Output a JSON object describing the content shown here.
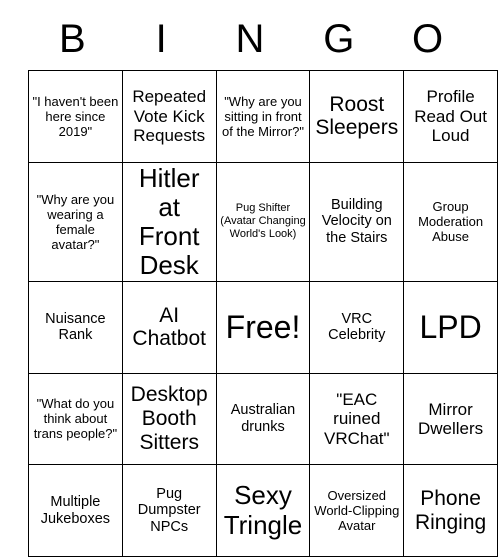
{
  "card": {
    "type": "bingo-card",
    "header": {
      "letters": [
        "B",
        "I",
        "N",
        "G",
        "O"
      ]
    },
    "grid": {
      "columns": 5,
      "rows": 5,
      "free_space_index": 12,
      "cells": [
        {
          "text": "\"I haven't been here since 2019\"",
          "size": "sm"
        },
        {
          "text": "Repeated Vote Kick Requests",
          "size": "lg"
        },
        {
          "text": "\"Why are you sitting in front of the Mirror?\"",
          "size": "sm"
        },
        {
          "text": "Roost Sleepers",
          "size": "xl"
        },
        {
          "text": "Profile Read Out Loud",
          "size": "lg"
        },
        {
          "text": "\"Why are you wearing a female avatar?\"",
          "size": "sm"
        },
        {
          "text": "Hitler at Front Desk",
          "size": "xxl"
        },
        {
          "text": "Pug Shifter (Avatar Changing World's Look)",
          "size": "xs"
        },
        {
          "text": "Building Velocity on the Stairs",
          "size": "md"
        },
        {
          "text": "Group Moderation Abuse",
          "size": "sm"
        },
        {
          "text": "Nuisance Rank",
          "size": "md"
        },
        {
          "text": "AI Chatbot",
          "size": "xl"
        },
        {
          "text": "Free!",
          "size": "huge"
        },
        {
          "text": "VRC Celebrity",
          "size": "md"
        },
        {
          "text": "LPD",
          "size": "huge"
        },
        {
          "text": "\"What do you think about trans people?\"",
          "size": "sm"
        },
        {
          "text": "Desktop Booth Sitters",
          "size": "xl"
        },
        {
          "text": "Australian drunks",
          "size": "md"
        },
        {
          "text": "\"EAC ruined VRChat\"",
          "size": "lg"
        },
        {
          "text": "Mirror Dwellers",
          "size": "lg"
        },
        {
          "text": "Multiple Jukeboxes",
          "size": "md"
        },
        {
          "text": "Pug Dumpster NPCs",
          "size": "md"
        },
        {
          "text": "Sexy Tringle",
          "size": "xxl"
        },
        {
          "text": "Oversized World-Clipping Avatar",
          "size": "sm"
        },
        {
          "text": "Phone Ringing",
          "size": "xl"
        }
      ]
    },
    "colors": {
      "background": "#ffffff",
      "text": "#000000",
      "border": "#000000"
    }
  }
}
